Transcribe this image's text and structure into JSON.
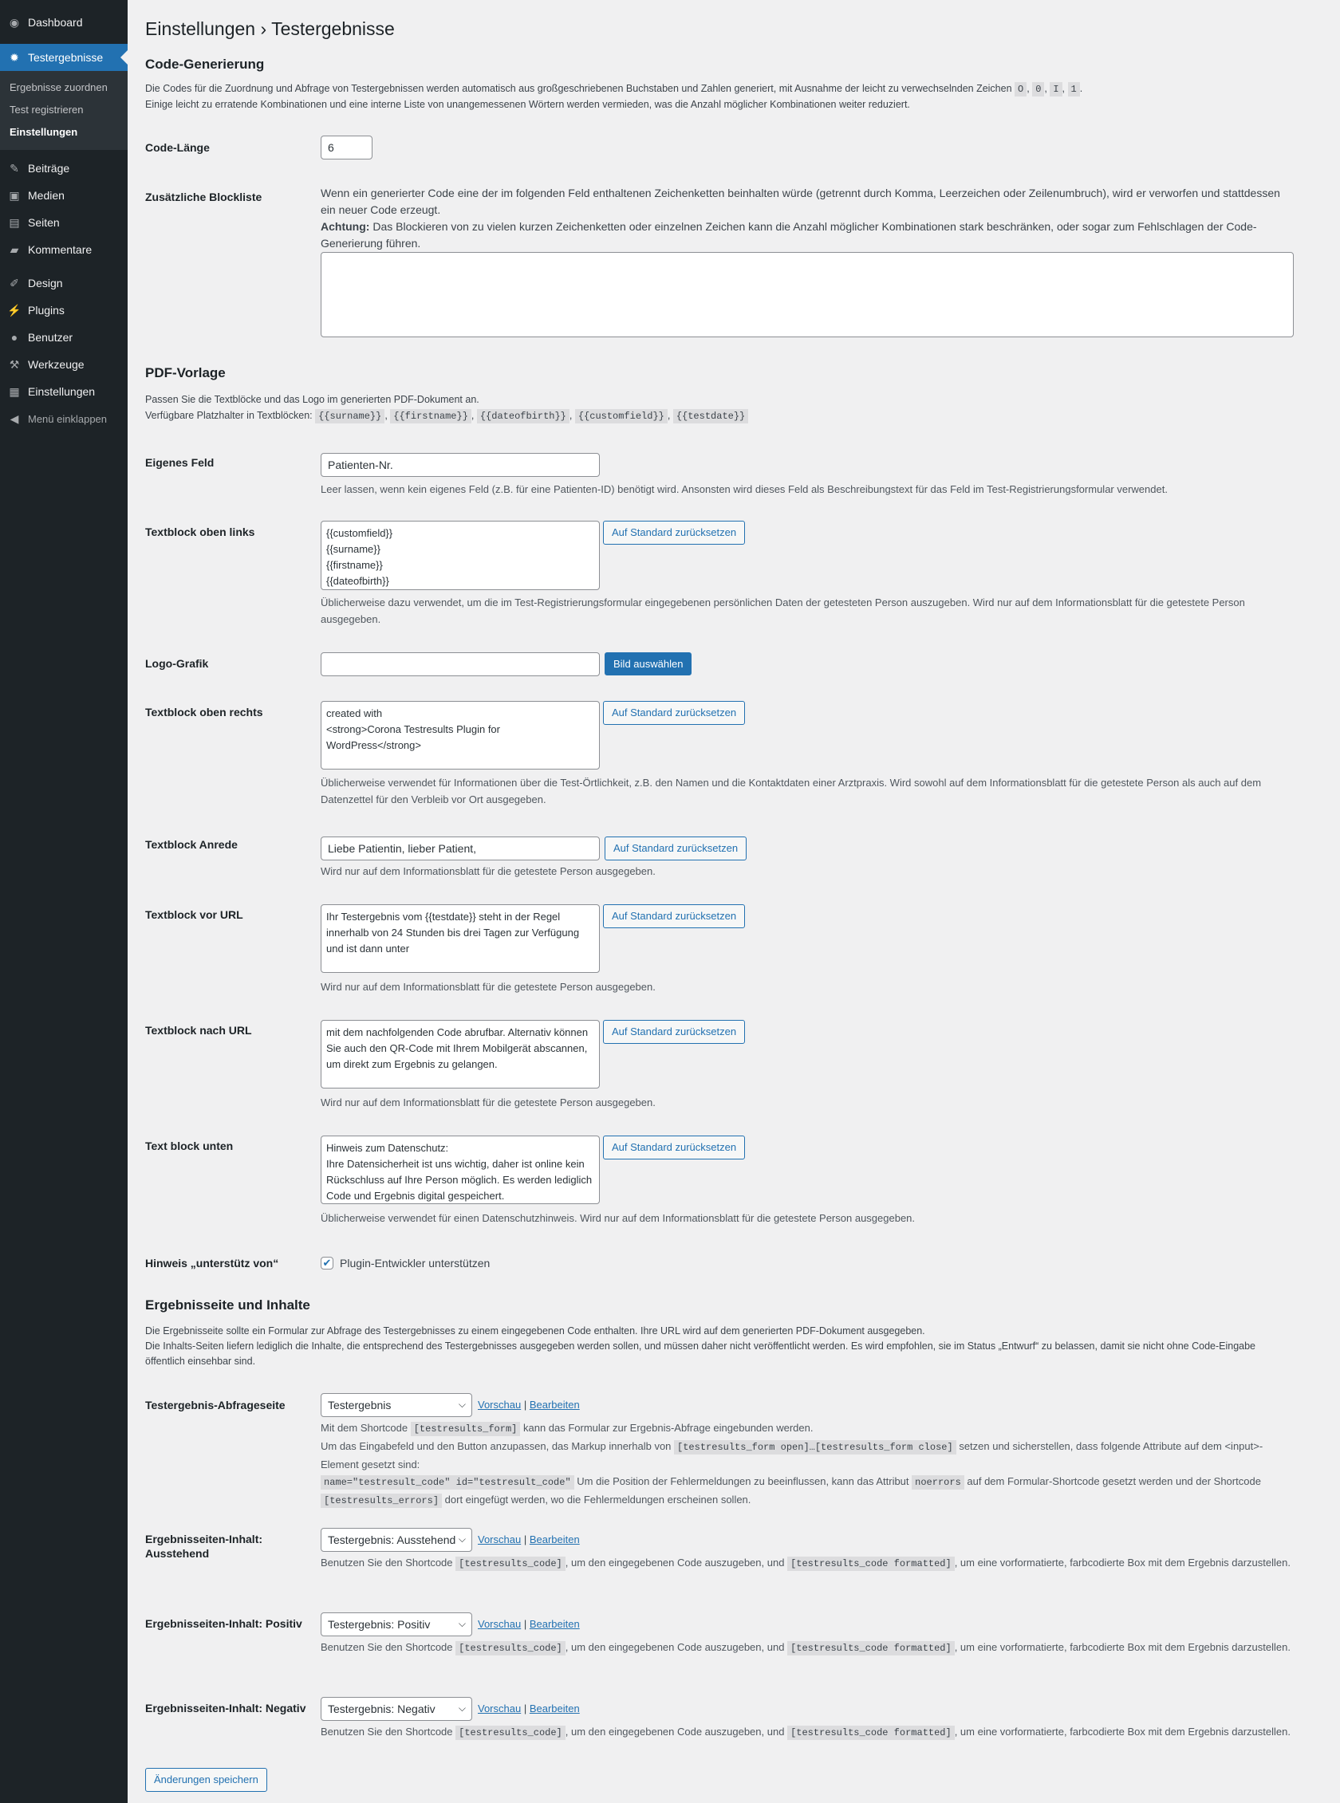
{
  "sidebar": {
    "dashboard": "Dashboard",
    "testergebnisse": "Testergebnisse",
    "submenu": [
      "Ergebnisse zuordnen",
      "Test registrieren",
      "Einstellungen"
    ],
    "items": [
      "Beiträge",
      "Medien",
      "Seiten",
      "Kommentare"
    ],
    "items2": [
      "Design",
      "Plugins",
      "Benutzer",
      "Werkzeuge",
      "Einstellungen"
    ],
    "collapse": "Menü einklappen"
  },
  "page": {
    "title": "Einstellungen › Testergebnisse"
  },
  "code_section": {
    "heading": "Code-Generierung",
    "desc_line1_a": "Die Codes für die Zuordnung und Abfrage von Testergebnissen werden automatisch aus großgeschriebenen Buchstaben und Zahlen generiert, mit Ausnahme der leicht zu verwechselnden Zeichen",
    "chars": [
      "O",
      "0",
      "I",
      "1"
    ],
    "desc_line2": "Einige leicht zu erratende Kombinationen und eine interne Liste von unangemessenen Wörtern werden vermieden, was die Anzahl möglicher Kombinationen weiter reduziert.",
    "length_label": "Code-Länge",
    "length_value": "6",
    "blocklist_label": "Zusätzliche Blockliste",
    "blocklist_help": "Wenn ein generierter Code eine der im folgenden Feld enthaltenen Zeichenketten beinhalten würde (getrennt durch Komma, Leerzeichen oder Zeilenumbruch), wird er verworfen und stattdessen ein neuer Code erzeugt.",
    "blocklist_warn_bold": "Achtung:",
    "blocklist_warn": "Das Blockieren von zu vielen kurzen Zeichenketten oder einzelnen Zeichen kann die Anzahl möglicher Kombinationen stark beschränken, oder sogar zum Fehlschlagen der Code-Generierung führen.",
    "blocklist_value": ""
  },
  "pdf_section": {
    "heading": "PDF-Vorlage",
    "desc1": "Passen Sie die Textblöcke und das Logo im generierten PDF-Dokument an.",
    "desc2": "Verfügbare Platzhalter in Textblöcken:",
    "placeholders": [
      "{{surname}}",
      "{{firstname}}",
      "{{dateofbirth}}",
      "{{customfield}}",
      "{{testdate}}"
    ],
    "custom_label": "Eigenes Feld",
    "custom_value": "Patienten-Nr.",
    "custom_help": "Leer lassen, wenn kein eigenes Feld (z.B. für eine Patienten-ID) benötigt wird. Ansonsten wird dieses Feld als Beschreibungstext für das Feld im Test-Registrierungsformular verwendet.",
    "tl_label": "Textblock oben links",
    "tl_value": "{{customfield}}\n{{surname}}\n{{firstname}}\n{{dateofbirth}}",
    "tl_help": "Üblicherweise dazu verwendet, um die im Test-Registrierungsformular eingegebenen persönlichen Daten der getesteten Person auszugeben. Wird nur auf dem Informationsblatt für die getestete Person ausgegeben.",
    "reset_label": "Auf Standard zurücksetzen",
    "logo_label": "Logo-Grafik",
    "logo_value": "",
    "logo_button": "Bild auswählen",
    "tr_label": "Textblock oben rechts",
    "tr_value": "created with\n<strong>Corona Testresults Plugin for WordPress</strong>",
    "tr_help": "Üblicherweise verwendet für Informationen über die Test-Örtlichkeit, z.B. den Namen und die Kontaktdaten einer Arztpraxis. Wird sowohl auf dem Informationsblatt für die getestete Person als auch auf dem Datenzettel für den Verbleib vor Ort ausgegeben.",
    "anrede_label": "Textblock Anrede",
    "anrede_value": "Liebe Patientin, lieber Patient,",
    "anrede_help": "Wird nur auf dem Informationsblatt für die getestete Person ausgegeben.",
    "vorurl_label": "Textblock vor URL",
    "vorurl_value": "Ihr Testergebnis vom {{testdate}} steht in der Regel innerhalb von 24 Stunden bis drei Tagen zur Verfügung und ist dann unter",
    "vorurl_help": "Wird nur auf dem Informationsblatt für die getestete Person ausgegeben.",
    "nachurl_label": "Textblock nach URL",
    "nachurl_value": "mit dem nachfolgenden Code abrufbar. Alternativ können Sie auch den QR-Code mit Ihrem Mobilgerät abscannen, um direkt zum Ergebnis zu gelangen.",
    "nachurl_help": "Wird nur auf dem Informationsblatt für die getestete Person ausgegeben.",
    "unten_label": "Text block unten",
    "unten_value": "Hinweis zum Datenschutz:\nIhre Datensicherheit ist uns wichtig, daher ist online kein Rückschluss auf Ihre Person möglich. Es werden lediglich Code und Ergebnis digital gespeichert.",
    "unten_help": "Üblicherweise verwendet für einen Datenschutzhinweis. Wird nur auf dem Informationsblatt für die getestete Person ausgegeben.",
    "support_label": "Hinweis „unterstütz von“",
    "support_check": "Plugin-Entwickler unterstützen",
    "support_checked": true
  },
  "result_section": {
    "heading": "Ergebnisseite und Inhalte",
    "desc1": "Die Ergebnisseite sollte ein Formular zur Abfrage des Testergebnisses zu einem eingegebenen Code enthalten. Ihre URL wird auf dem generierten PDF-Dokument ausgegeben.",
    "desc2": "Die Inhalts-Seiten liefern lediglich die Inhalte, die entsprechend des Testergebnisses ausgegeben werden sollen, und müssen daher nicht veröffentlicht werden. Es wird empfohlen, sie im Status „Entwurf“ zu belassen, damit sie nicht ohne Code-Eingabe öffentlich einsehbar sind.",
    "preview": "Vorschau",
    "edit": "Bearbeiten",
    "sep": "|",
    "abfrage_label": "Testergebnis-Abfrageseite",
    "abfrage_value": "Testergebnis",
    "abfrage_help_a": "Mit dem Shortcode",
    "abfrage_code1": "[testresults_form]",
    "abfrage_help_b": "kann das Formular zur Ergebnis-Abfrage eingebunden werden.",
    "abfrage_help_c": "Um das Eingabefeld und den Button anzupassen, das Markup innerhalb von",
    "abfrage_code2": "[testresults_form open]…[testresults_form close]",
    "abfrage_help_d": "setzen und sicherstellen, dass folgende Attribute auf dem <input>-Element gesetzt sind:",
    "abfrage_code3": "name=\"testresult_code\" id=\"testresult_code\"",
    "abfrage_help_e": "Um die Position der Fehlermeldungen zu beeinflussen, kann das Attribut",
    "abfrage_code4": "noerrors",
    "abfrage_help_f": "auf dem Formular-Shortcode gesetzt werden und der Shortcode",
    "abfrage_code5": "[testresults_errors]",
    "abfrage_help_g": "dort eingefügt werden, wo die Fehlermeldungen erscheinen sollen.",
    "aus_label": "Ergebnisseiten-Inhalt: Ausstehend",
    "aus_value": "Testergebnis: Ausstehend",
    "pos_label": "Ergebnisseiten-Inhalt: Positiv",
    "pos_value": "Testergebnis: Positiv",
    "neg_label": "Ergebnisseiten-Inhalt: Negativ",
    "neg_value": "Testergebnis: Negativ",
    "content_help_a": "Benutzen Sie den Shortcode",
    "content_code1": "[testresults_code]",
    "content_help_b": ", um den eingegebenen Code auszugeben, und",
    "content_code2": "[testresults_code formatted]",
    "content_help_c": ", um eine vorformatierte, farbcodierte Box mit dem Ergebnis darzustellen."
  },
  "save_button": "Änderungen speichern"
}
